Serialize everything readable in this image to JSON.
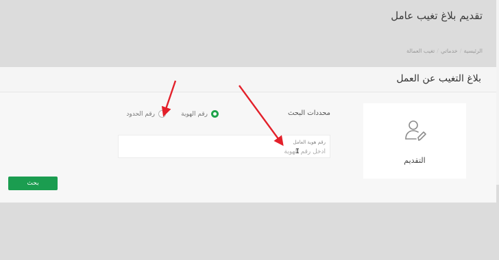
{
  "page": {
    "title": "تقديم بلاغ تغيب عامل"
  },
  "breadcrumb": {
    "items": [
      "الرئيسية",
      "خدماتي",
      "تغيب العمالة"
    ]
  },
  "panel": {
    "title": "بلاغ التغيب عن العمل"
  },
  "step": {
    "label": "التقديم",
    "icon": "user-edit-icon"
  },
  "search_criteria": {
    "label": "محددات البحث",
    "options": [
      {
        "label": "رقم الهوية",
        "selected": true
      },
      {
        "label": "رقم الحدود",
        "selected": false
      }
    ]
  },
  "id_field": {
    "label": "رقم هوية العامل",
    "placeholder": "أدخل رقم الهوية"
  },
  "search_button": {
    "label": "بحث"
  },
  "colors": {
    "accent": "#1b9d50",
    "annotation_arrow": "#e3202a"
  }
}
